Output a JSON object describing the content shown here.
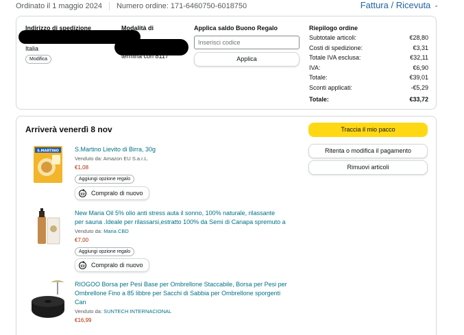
{
  "header": {
    "order_date": "Ordinato il 1 maggio 2024",
    "order_number": "Numero ordine: 171-6460750-6018750",
    "invoice_label": "Fattura / Ricevuta"
  },
  "order_info": {
    "shipping_address_title": "Indirizzo di spedizione",
    "shipping_address_country": "Italia",
    "modify_label": "Modifica",
    "payment_method_title": "Modalità di",
    "payment_method_detail": "termina con 8117",
    "gift_card_title": "Applica saldo Buono Regalo",
    "gift_card_placeholder": "Inserisci codice",
    "apply_label": "Applica"
  },
  "summary": {
    "title": "Riepilogo ordine",
    "rows": [
      {
        "label": "Subtotale articoli:",
        "value": "€28,80"
      },
      {
        "label": "Costi di spedizione:",
        "value": "€3,31"
      },
      {
        "label": "Totale IVA esclusa:",
        "value": "€32,11"
      },
      {
        "label": "IVA:",
        "value": "€6,90"
      },
      {
        "label": "Totale:",
        "value": "€39,01"
      },
      {
        "label": "Sconti applicati:",
        "value": "-€5,29"
      }
    ],
    "grand_label": "Totale:",
    "grand_value": "€33,72"
  },
  "delivery": {
    "title": "Arriverà venerdì 8 nov",
    "track_label": "Traccia il mio pacco",
    "retry_label": "Ritenta o modifica il pagamento",
    "remove_label": "Rimuovi articoli"
  },
  "items": [
    {
      "title_lines": [
        "S.Martino Lievito di Birra, 30g"
      ],
      "sold_prefix": "Venduto da:",
      "seller": "Amazon EU S.a.r.L.",
      "price": "€1,08",
      "gift_label": "Aggiungi opzione regalo",
      "rebuy_label": "Compralo di nuovo"
    },
    {
      "title_lines": [
        "New Maria Oil 5% olio anti stress auta il sonno, 100% naturale, rilassante",
        "per sauna .Ideale per rilassarsi,estratto 100% da Semi di Canapa spremuto a"
      ],
      "sold_prefix": "Venduto da:",
      "seller": "Maria CBD",
      "price": "€7,00",
      "gift_label": "Aggiungi opzione regalo",
      "rebuy_label": "Compralo di nuovo"
    },
    {
      "title_lines": [
        "RIOGOO Borsa per Pesi Base per Ombrellone Staccabile, Borsa per Pesi per",
        "Ombrellone Fino a 85 libbre per Sacchi di Sabbia per Ombrellone sporgenti",
        "Can"
      ],
      "sold_prefix": "Venduto da:",
      "seller": "SUNTECH INTERNACIONAL",
      "price": "€16,99"
    }
  ],
  "colors": {
    "link": "#007185",
    "price": "#b12704",
    "primary_button": "#ffd814",
    "invoice_link": "#2162a1"
  }
}
